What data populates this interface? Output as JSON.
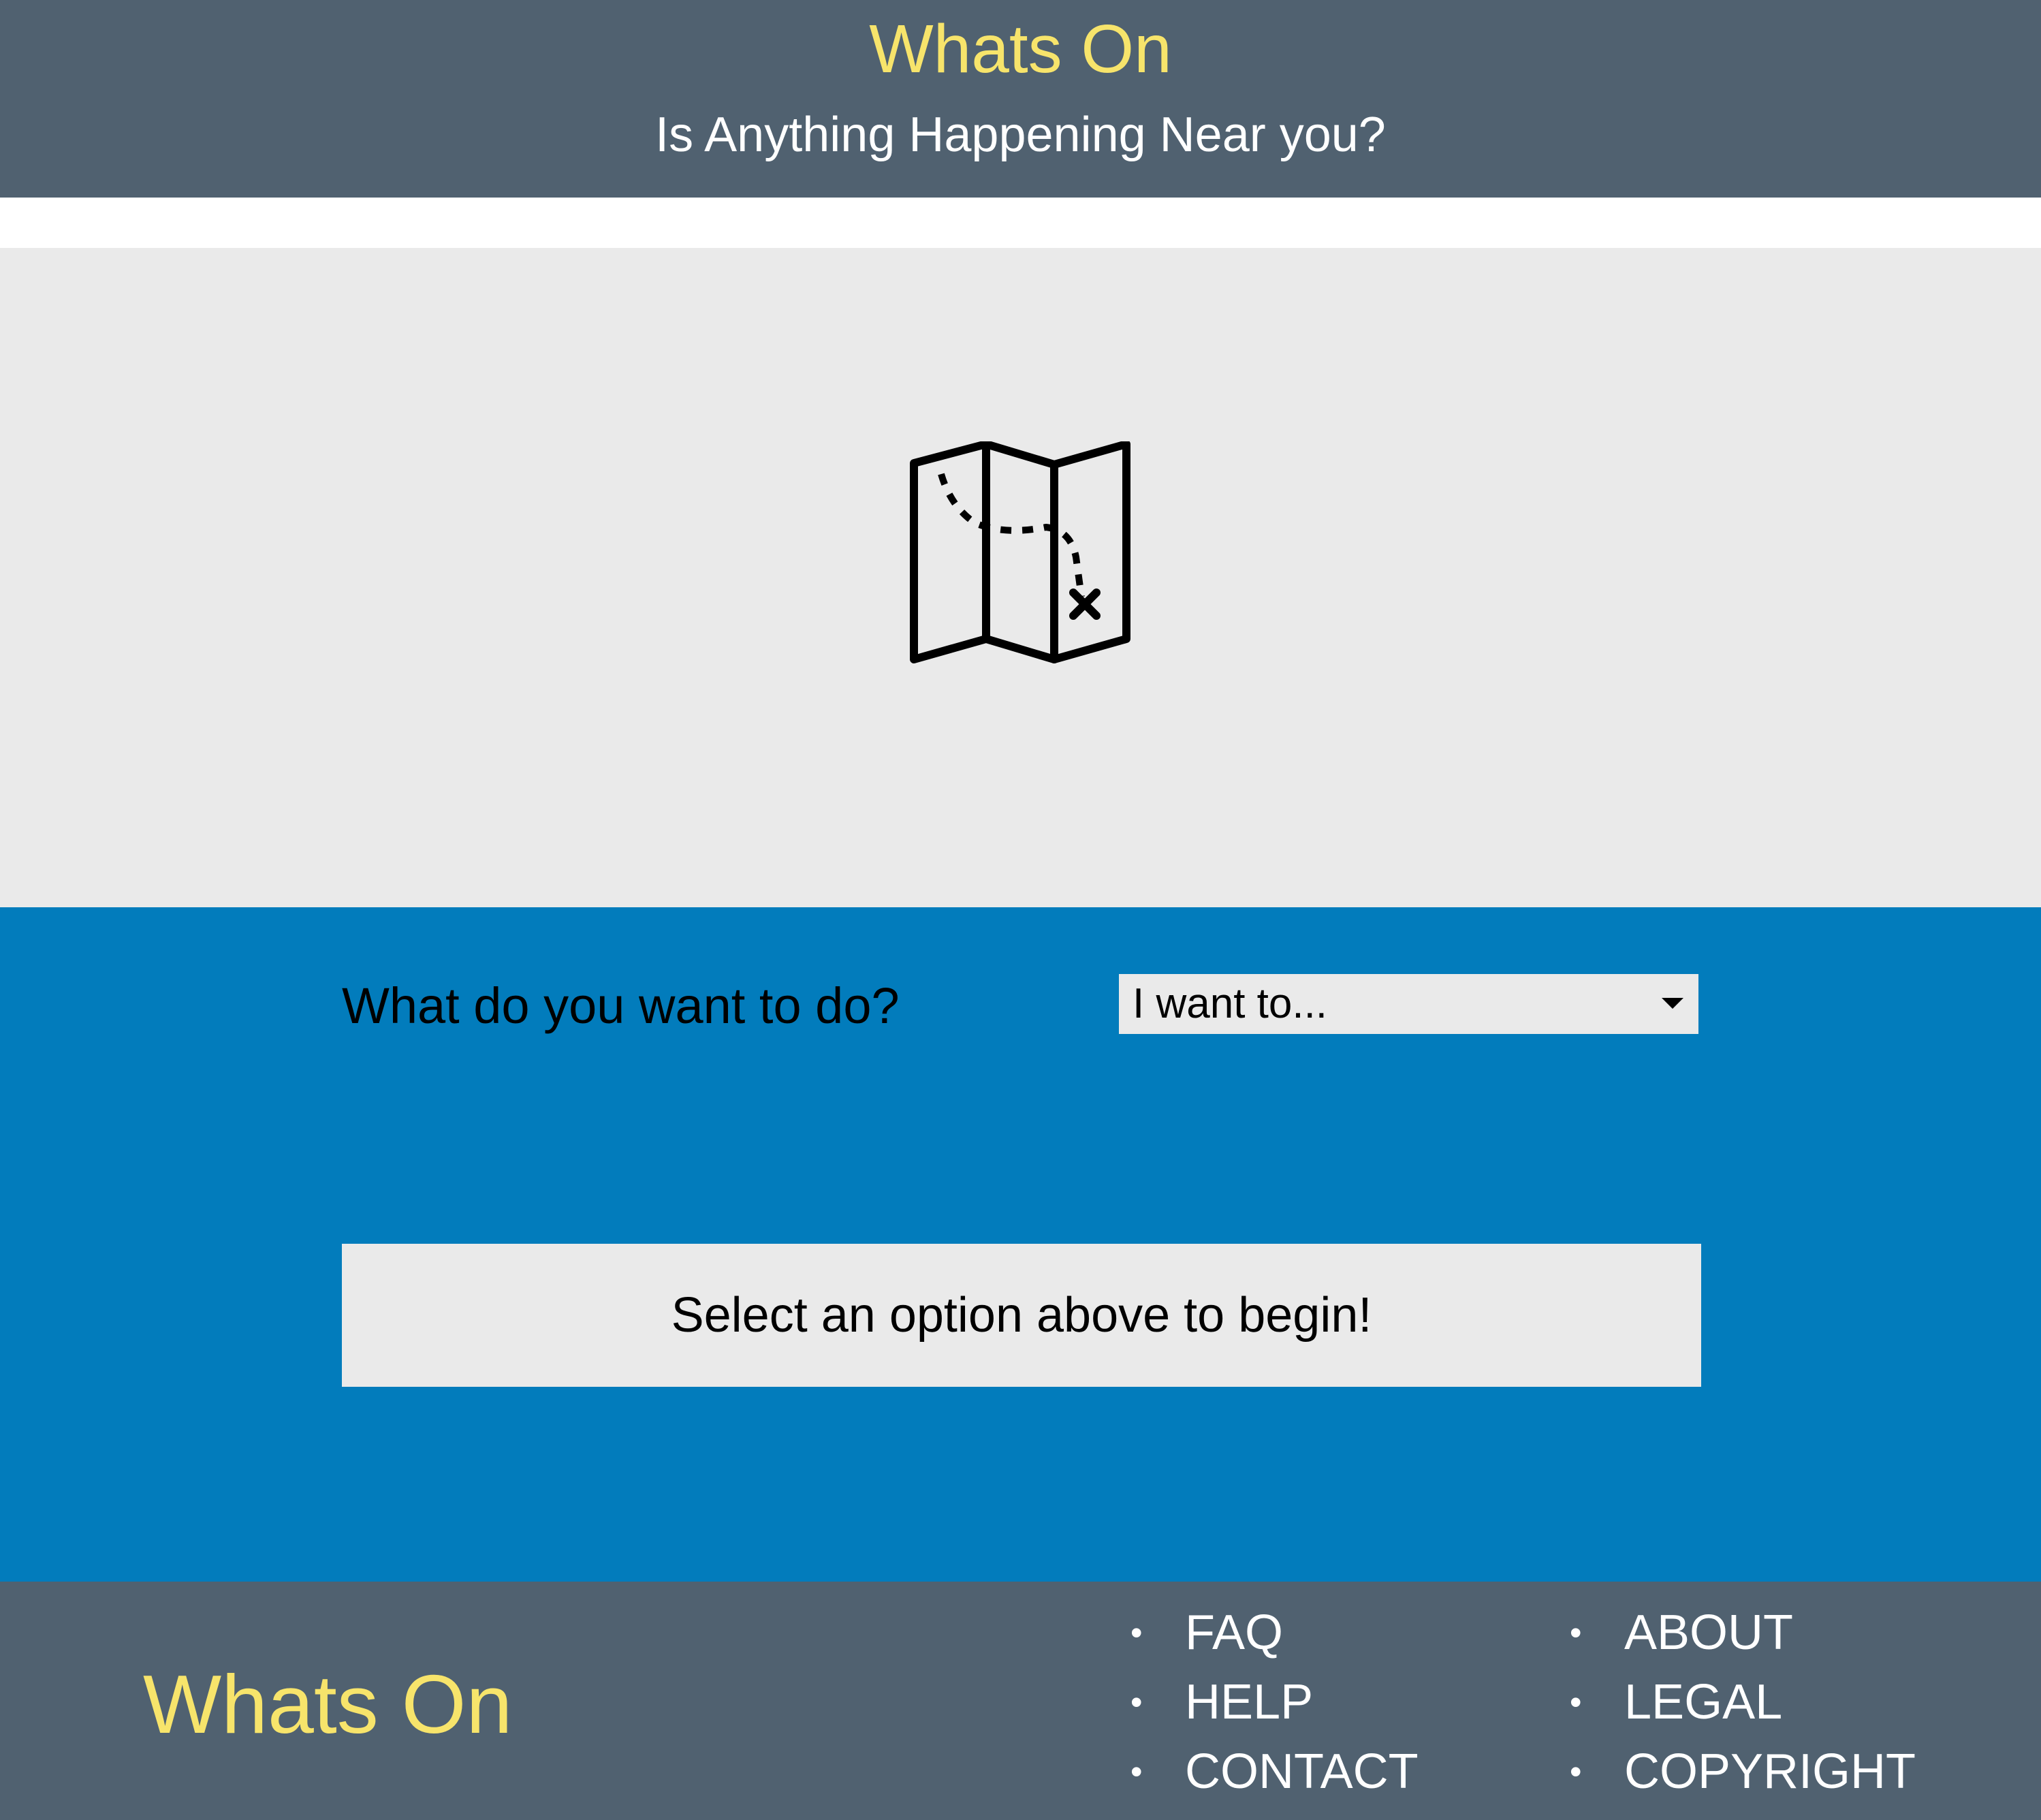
{
  "header": {
    "title": "Whats On",
    "tagline": "Is Anything Happening Near you?"
  },
  "hero": {
    "icon": "map-icon"
  },
  "action": {
    "question": "What do you want to do?",
    "select": {
      "selected": "I want to...",
      "icon": "chevron-down-icon"
    },
    "status": "Select an option above to begin!"
  },
  "footer": {
    "brand": "Whats On",
    "links_col1": [
      "FAQ",
      "HELP",
      "CONTACT"
    ],
    "links_col2": [
      "ABOUT",
      "LEGAL",
      "COPYRIGHT"
    ],
    "bullet": "•"
  },
  "colors": {
    "header_bg": "#506170",
    "brand_yellow": "#f7e46b",
    "hero_bg": "#eaeaea",
    "panel_blue": "#027cbc"
  }
}
